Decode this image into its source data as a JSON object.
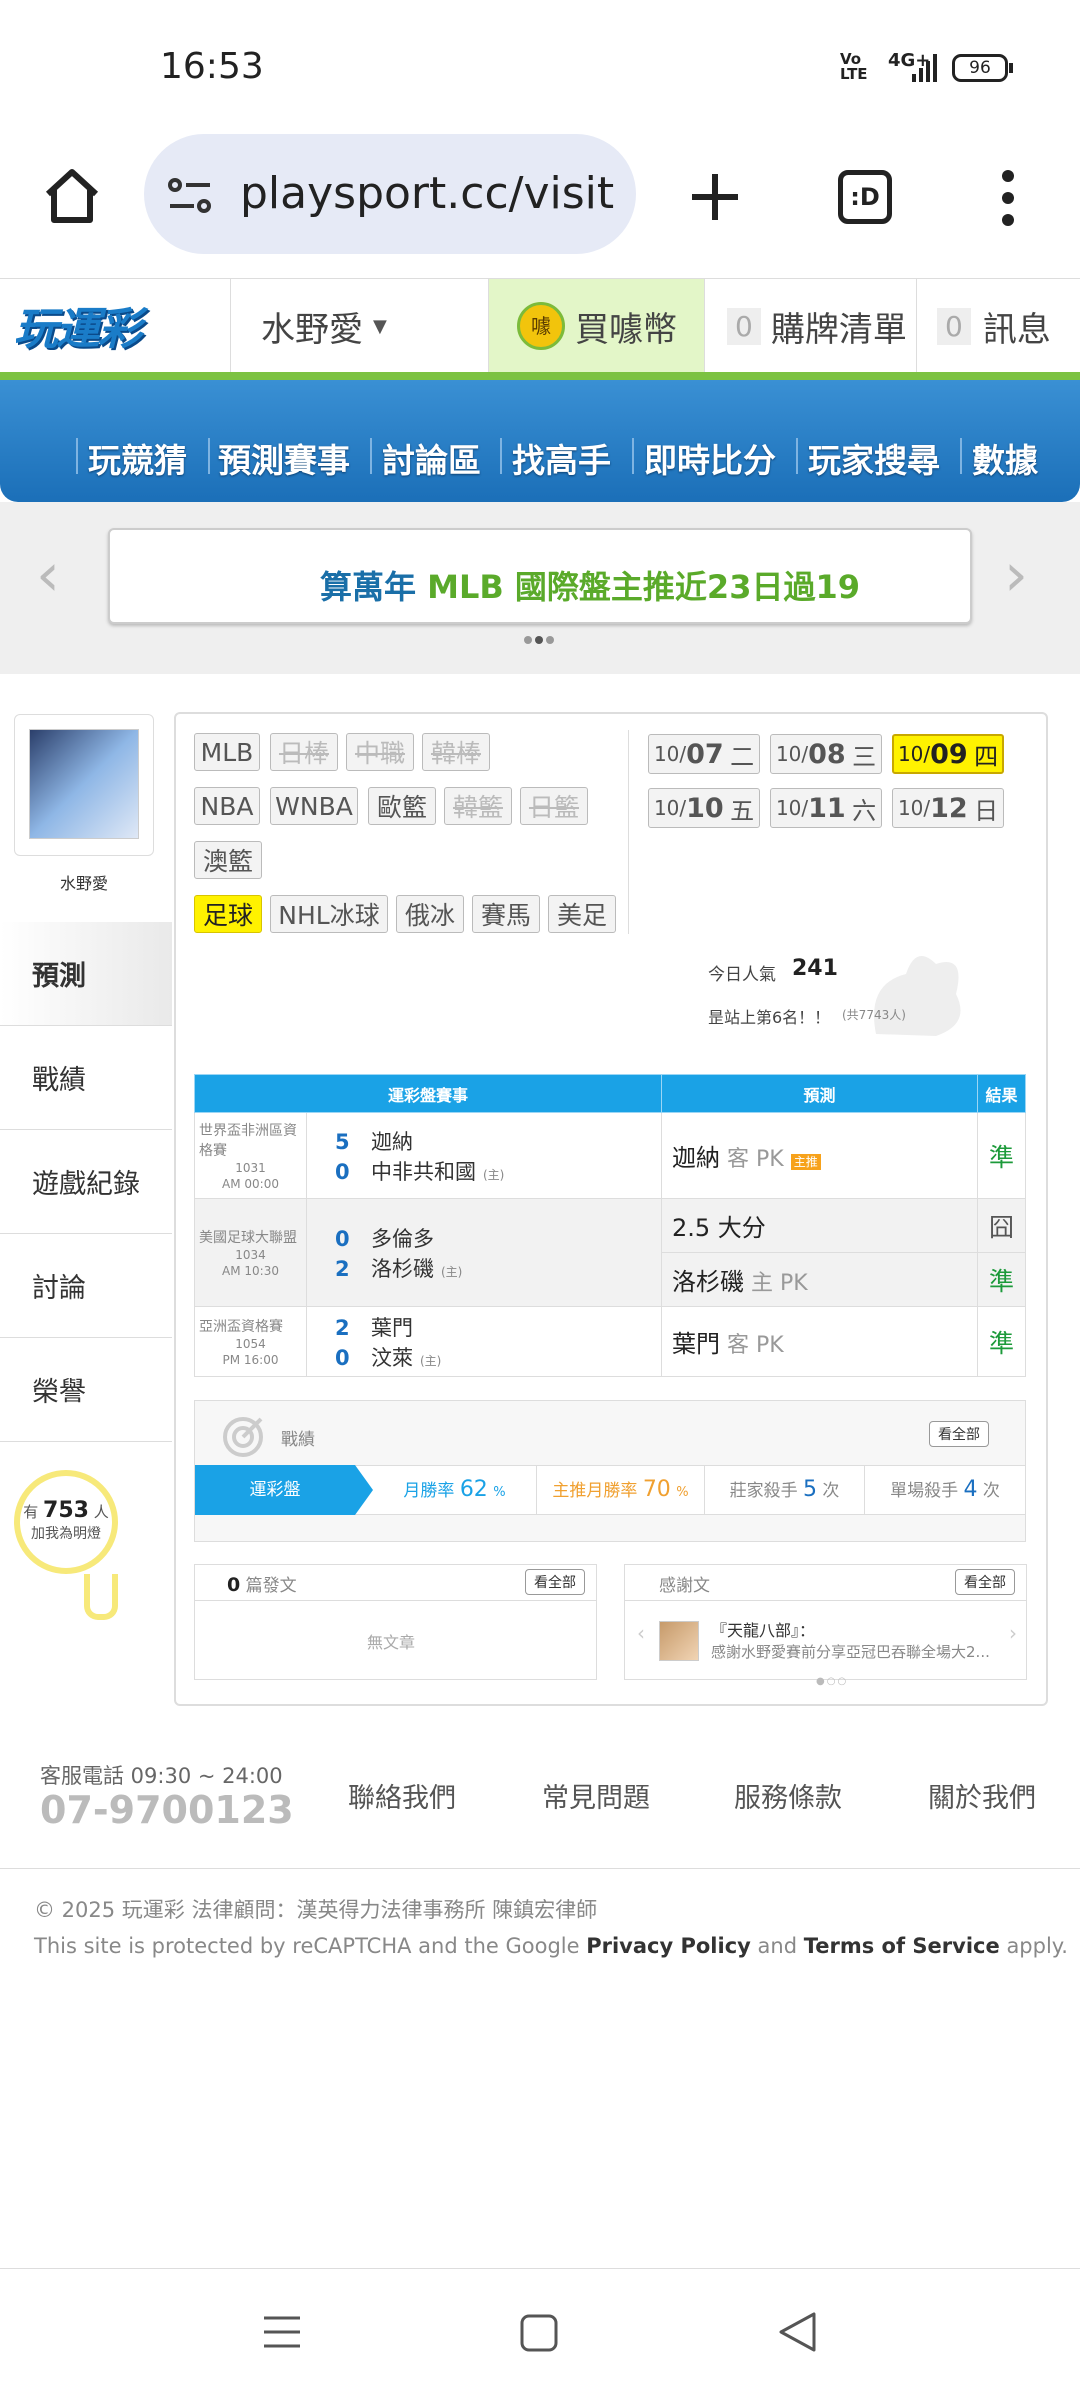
{
  "status": {
    "time": "16:53",
    "network": "4G+",
    "volte": "Vo LTE",
    "battery": "96"
  },
  "browser": {
    "url": "playsport.cc/visit",
    "tabs": ":D",
    "home_icon": "home-icon",
    "menu_icon": "more-vert-icon"
  },
  "header": {
    "logo": "玩運彩",
    "user": "水野愛",
    "buy": "買噱幣",
    "buy_coin": "噱",
    "cart_count": "0",
    "cart": "購牌清單",
    "msg_count": "0",
    "msg": "訊息"
  },
  "nav": [
    "玩競猜",
    "預測賽事",
    "討論區",
    "找高手",
    "即時比分",
    "玩家搜尋",
    "數據"
  ],
  "banner": {
    "prefix": "算萬年",
    "mid": "MLB",
    "suffix": "國際盤主推近23日過19"
  },
  "profile": {
    "name": "水野愛",
    "menu": [
      "預測",
      "戰績",
      "遊戲紀錄",
      "討論",
      "榮譽"
    ],
    "active": "預測",
    "likes_pre": "有",
    "likes_count": "753",
    "likes_post": "人",
    "likes_sub": "加我為明燈"
  },
  "sports": [
    {
      "label": "MLB",
      "state": "on"
    },
    {
      "label": "日棒",
      "state": "off"
    },
    {
      "label": "中職",
      "state": "off"
    },
    {
      "label": "韓棒",
      "state": "off"
    },
    {
      "label": "NBA",
      "state": "on"
    },
    {
      "label": "WNBA",
      "state": "on"
    },
    {
      "label": "歐籃",
      "state": "on"
    },
    {
      "label": "韓籃",
      "state": "off"
    },
    {
      "label": "日籃",
      "state": "off"
    },
    {
      "label": "澳籃",
      "state": "on"
    },
    {
      "label": "足球",
      "state": "sel"
    },
    {
      "label": "NHL冰球",
      "state": "on"
    },
    {
      "label": "俄冰",
      "state": "on"
    },
    {
      "label": "賽馬",
      "state": "on"
    },
    {
      "label": "美足",
      "state": "on"
    }
  ],
  "dates": [
    {
      "m": "10/",
      "d": "07",
      "w": "二",
      "sel": false
    },
    {
      "m": "10/",
      "d": "08",
      "w": "三",
      "sel": false
    },
    {
      "m": "10/",
      "d": "09",
      "w": "四",
      "sel": true
    },
    {
      "m": "10/",
      "d": "10",
      "w": "五",
      "sel": false
    },
    {
      "m": "10/",
      "d": "11",
      "w": "六",
      "sel": false
    },
    {
      "m": "10/",
      "d": "12",
      "w": "日",
      "sel": false
    }
  ],
  "popularity": {
    "label": "今日人氣",
    "value": "241",
    "rank": "昰站上第6名！！",
    "total": "(共7743人)"
  },
  "table": {
    "headers": [
      "運彩盤賽事",
      "預測",
      "結果"
    ],
    "home_mark": "(主)",
    "g1": {
      "league": "世界盃非洲區資格賽",
      "no": "1031",
      "time": "AM 00:00",
      "s1": "5",
      "t1": "迦納",
      "s2": "0",
      "t2": "中非共和國",
      "pick": "迦納",
      "pick_type": "客 PK",
      "tag": "主推",
      "result": "準"
    },
    "g2": {
      "league": "美國足球大聯盟",
      "no": "1034",
      "time": "AM 10:30",
      "s1": "0",
      "t1": "多倫多",
      "s2": "2",
      "t2": "洛杉磯",
      "pick1": "2.5 大分",
      "result1": "囧",
      "pick2": "洛杉磯",
      "pick2_type": "主 PK",
      "result2": "準"
    },
    "g3": {
      "league": "亞洲盃資格賽",
      "no": "1054",
      "time": "PM 16:00",
      "s1": "2",
      "t1": "葉門",
      "s2": "0",
      "t2": "汶萊",
      "pick": "葉門",
      "pick_type": "客 PK",
      "result": "準"
    }
  },
  "stats": {
    "title": "戰績",
    "all": "看全部",
    "tab": "運彩盤",
    "m_label": "月勝率",
    "m_val": "62",
    "h_label": "主推月勝率",
    "h_val": "70",
    "pct": "%",
    "b_label": "莊家殺手",
    "b_val": "5",
    "s_label": "單場殺手",
    "s_val": "4",
    "unit": "次"
  },
  "posts": {
    "count": "0",
    "label": "篇發文",
    "all": "看全部",
    "empty": "無文章"
  },
  "thanks": {
    "label": "感謝文",
    "all": "看全部",
    "name": "『天龍八部』：",
    "text": "感謝水野愛賽前分享亞冠巴吞聯全場大2..."
  },
  "footer": {
    "phone_label": "客服電話 09:30 ~ 24:00",
    "phone": "07-9700123",
    "links": [
      "聯絡我們",
      "常見問題",
      "服務條款",
      "關於我們"
    ],
    "copyright": "© 2025 玩運彩 法律顧問：漢英得力法律事務所 陳鎮宏律師",
    "recaptcha_pre": "This site is protected by reCAPTCHA and the Google",
    "privacy": "Privacy Policy",
    "and": "and",
    "tos": "Terms of Service",
    "apply": "apply."
  }
}
